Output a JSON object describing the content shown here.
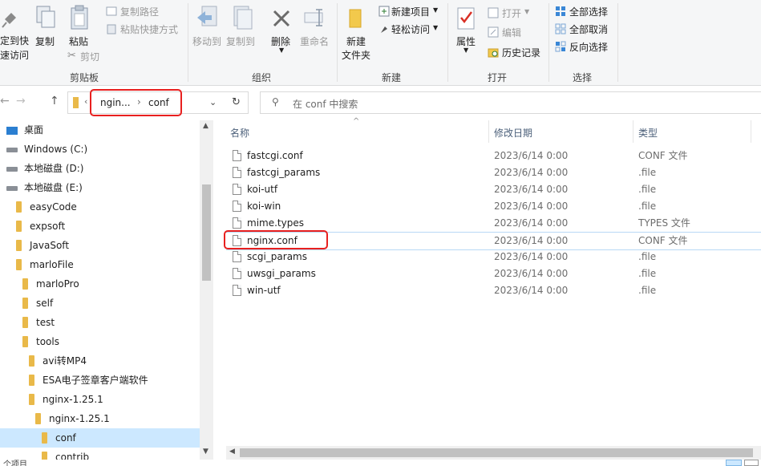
{
  "ribbon": {
    "clipboard": {
      "pin_label_1": "定到快",
      "pin_label_2": "速访问",
      "copy": "复制",
      "paste": "粘贴",
      "copy_path": "复制路径",
      "paste_shortcut": "粘贴快捷方式",
      "cut": "剪切",
      "group": "剪贴板"
    },
    "organize": {
      "move_to": "移动到",
      "copy_to": "复制到",
      "delete": "删除",
      "rename": "重命名",
      "group": "组织"
    },
    "new": {
      "new_folder_1": "新建",
      "new_folder_2": "文件夹",
      "new_item": "新建项目",
      "easy_access": "轻松访问",
      "group": "新建"
    },
    "open": {
      "properties": "属性",
      "open": "打开",
      "edit": "编辑",
      "history": "历史记录",
      "group": "打开"
    },
    "select": {
      "select_all": "全部选择",
      "select_none": "全部取消",
      "invert": "反向选择",
      "group": "选择"
    }
  },
  "address": {
    "crumb1": "ngin...",
    "sep": "›",
    "crumb2": "conf",
    "search_placeholder": "在 conf 中搜索"
  },
  "nav": {
    "items": [
      {
        "label": "桌面",
        "kind": "desktop"
      },
      {
        "label": "Windows (C:)",
        "kind": "drive"
      },
      {
        "label": "本地磁盘 (D:)",
        "kind": "drive"
      },
      {
        "label": "本地磁盘 (E:)",
        "kind": "drive"
      },
      {
        "label": "easyCode",
        "kind": "folder"
      },
      {
        "label": "expsoft",
        "kind": "folder"
      },
      {
        "label": "JavaSoft",
        "kind": "folder"
      },
      {
        "label": "marloFile",
        "kind": "folder"
      },
      {
        "label": "marloPro",
        "kind": "folder"
      },
      {
        "label": "self",
        "kind": "folder"
      },
      {
        "label": "test",
        "kind": "folder"
      },
      {
        "label": "tools",
        "kind": "folder"
      },
      {
        "label": "avi转MP4",
        "kind": "folder"
      },
      {
        "label": "ESA电子签章客户端软件",
        "kind": "folder"
      },
      {
        "label": "nginx-1.25.1",
        "kind": "folder"
      },
      {
        "label": "nginx-1.25.1",
        "kind": "folder"
      },
      {
        "label": "conf",
        "kind": "folder"
      },
      {
        "label": "contrib",
        "kind": "folder"
      }
    ]
  },
  "list": {
    "headers": {
      "name": "名称",
      "date": "修改日期",
      "type": "类型"
    },
    "files": [
      {
        "name": "fastcgi.conf",
        "date": "2023/6/14 0:00",
        "type": "CONF 文件"
      },
      {
        "name": "fastcgi_params",
        "date": "2023/6/14 0:00",
        "type": ".file"
      },
      {
        "name": "koi-utf",
        "date": "2023/6/14 0:00",
        "type": ".file"
      },
      {
        "name": "koi-win",
        "date": "2023/6/14 0:00",
        "type": ".file"
      },
      {
        "name": "mime.types",
        "date": "2023/6/14 0:00",
        "type": "TYPES 文件"
      },
      {
        "name": "nginx.conf",
        "date": "2023/6/14 0:00",
        "type": "CONF 文件"
      },
      {
        "name": "scgi_params",
        "date": "2023/6/14 0:00",
        "type": ".file"
      },
      {
        "name": "uwsgi_params",
        "date": "2023/6/14 0:00",
        "type": ".file"
      },
      {
        "name": "win-utf",
        "date": "2023/6/14 0:00",
        "type": ".file"
      }
    ]
  },
  "statusbar": {
    "text": "个项目"
  },
  "colors": {
    "accent": "#0078d7",
    "highlight": "#e8201f",
    "selection": "#cce8ff",
    "folder": "#e9b949"
  }
}
